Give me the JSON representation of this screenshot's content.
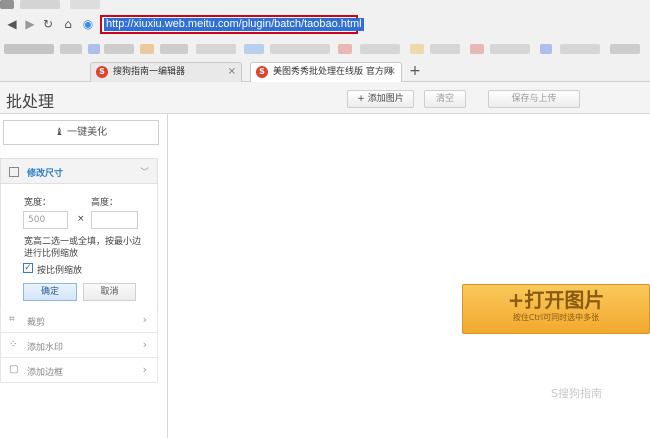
{
  "browser": {
    "url": "http://xiuxiu.web.meitu.com/plugin/batch/taobao.html",
    "new_tab": "+",
    "tabs": [
      {
        "favicon": "S",
        "title": "搜狗指南一编辑器",
        "close": "×"
      },
      {
        "favicon": "S",
        "title": "美图秀秀批处理在线版 官方网",
        "close": "×"
      }
    ]
  },
  "app": {
    "title": "批处理",
    "toolbar": {
      "add_image": "+ 添加图片",
      "clear": "清空",
      "save_upload": "保存与上传"
    }
  },
  "sidebar": {
    "one_click_beautify": "一键美化",
    "resize": {
      "title": "修改尺寸",
      "width_label": "宽度：",
      "height_label": "高度：",
      "width_value": "500",
      "times": "×",
      "height_value": "",
      "hint": "宽高二选一或全填，按最小边进行比例缩放",
      "keep_ratio_label": "按比例缩放",
      "keep_ratio_checked": true,
      "ok": "确定",
      "cancel": "取消"
    },
    "tools": [
      {
        "label": "裁剪",
        "icon": "crop-icon"
      },
      {
        "label": "添加水印",
        "icon": "watermark-icon"
      },
      {
        "label": "添加边框",
        "icon": "border-icon"
      }
    ]
  },
  "main": {
    "open_image": "+打开图片",
    "open_hint": "按住Ctrl可同时选中多张"
  },
  "watermark": "S搜狗指南",
  "colors": {
    "url_highlight_border": "#d0021b",
    "open_button": "#f2a92e",
    "section_title": "#2a7cc7"
  }
}
